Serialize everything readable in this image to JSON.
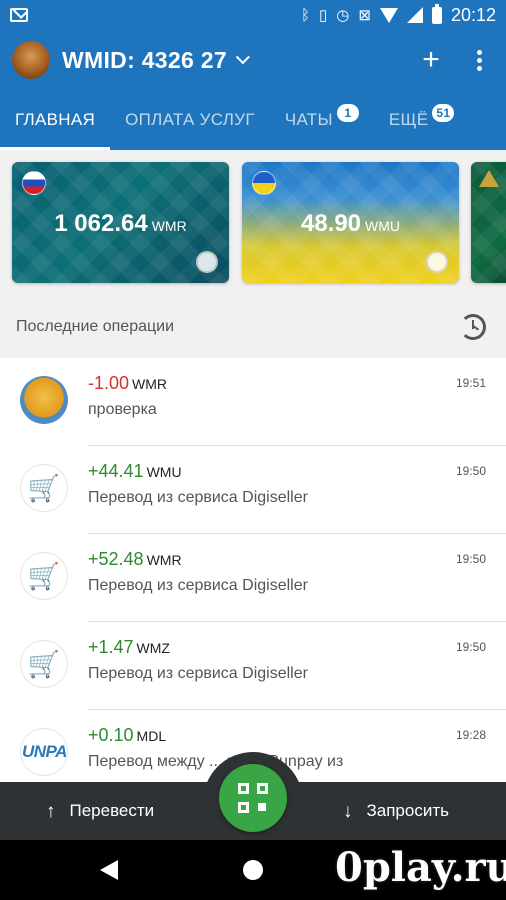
{
  "status_bar": {
    "time": "20:12"
  },
  "app_bar": {
    "wmid": "WMID: 4326            27"
  },
  "tabs": [
    {
      "label": "ГЛАВНАЯ",
      "active": true
    },
    {
      "label": "ОПЛАТА УСЛУГ"
    },
    {
      "label": "ЧАТЫ",
      "badge": "1"
    },
    {
      "label": "ЕЩЁ",
      "badge": "51"
    }
  ],
  "cards": [
    {
      "amount": "1 062.64",
      "currency": "WMR",
      "flag": "russia-flag-icon"
    },
    {
      "amount": "48.90",
      "currency": "WMU",
      "flag": "ukraine-flag-icon"
    }
  ],
  "section": {
    "title": "Последние операции"
  },
  "operations": [
    {
      "amount": "-1.00",
      "currency": "WMR",
      "desc": "проверка",
      "time": "19:51",
      "icon": "user-avatar"
    },
    {
      "amount": "+44.41",
      "currency": "WMU",
      "desc": "Перевод из сервиса Digiseller",
      "time": "19:50",
      "icon": "digiseller-cart-icon"
    },
    {
      "amount": "+52.48",
      "currency": "WMR",
      "desc": "Перевод из сервиса Digiseller",
      "time": "19:50",
      "icon": "digiseller-cart-icon"
    },
    {
      "amount": "+1.47",
      "currency": "WMZ",
      "desc": "Перевод из сервиса Digiseller",
      "time": "19:50",
      "icon": "digiseller-cart-icon"
    },
    {
      "amount": "+0.10",
      "currency": "MDL",
      "desc": "Перевод между ... ками Runpay из",
      "time": "19:28",
      "icon": "runpay-logo",
      "icon_text": "UNPA"
    }
  ],
  "actions": {
    "send": "Перевести",
    "request": "Запросить"
  },
  "watermark": "0play.ru",
  "colors": {
    "primary": "#1e74bd",
    "positive": "#2f8a2f",
    "negative": "#d7312e",
    "fab": "#3aa544",
    "action_bar": "#2f3234"
  }
}
